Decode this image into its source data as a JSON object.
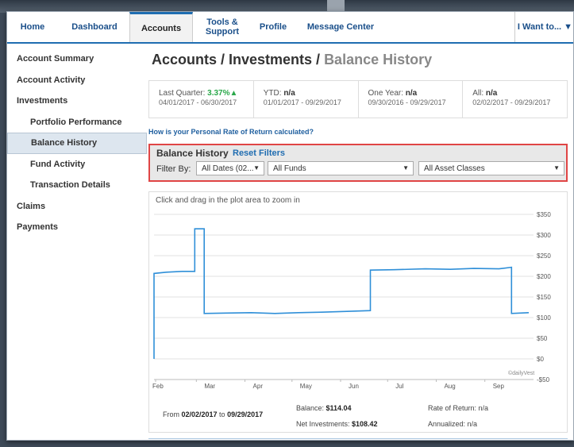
{
  "nav": {
    "items": [
      "Home",
      "Dashboard",
      "Accounts",
      "Tools & Support",
      "Profile",
      "Message Center"
    ],
    "iwant": "I Want to... ▼"
  },
  "sidebar": [
    {
      "label": "Account Summary",
      "sub": false
    },
    {
      "label": "Account Activity",
      "sub": false
    },
    {
      "label": "Investments",
      "sub": false
    },
    {
      "label": "Portfolio Performance",
      "sub": true
    },
    {
      "label": "Balance History",
      "sub": true,
      "active": true
    },
    {
      "label": "Fund Activity",
      "sub": true
    },
    {
      "label": "Transaction Details",
      "sub": true
    },
    {
      "label": "Claims",
      "sub": false
    },
    {
      "label": "Payments",
      "sub": false
    }
  ],
  "page": {
    "title_main": "Accounts / Investments / ",
    "title_sub": "Balance History"
  },
  "stats": [
    {
      "label": "Last Quarter: ",
      "value": "3.37%▲",
      "up": true,
      "dates": "04/01/2017 - 06/30/2017"
    },
    {
      "label": "YTD: ",
      "value": "n/a",
      "up": false,
      "dates": "01/01/2017 - 09/29/2017"
    },
    {
      "label": "One Year: ",
      "value": "n/a",
      "up": false,
      "dates": "09/30/2016 - 09/29/2017"
    },
    {
      "label": "All: ",
      "value": "n/a",
      "up": false,
      "dates": "02/02/2017 - 09/29/2017"
    }
  ],
  "ror_link": "How is your Personal Rate of Return calculated?",
  "filter": {
    "title": "Balance History",
    "reset": "Reset Filters",
    "label": "Filter By:",
    "dates": "All Dates (02...",
    "funds": "All Funds",
    "assets": "All Asset Classes"
  },
  "chart_hint": "Click and drag in the plot area to zoom in",
  "chart_data": {
    "type": "line",
    "credit": "©dailyVest",
    "xlabels": [
      "Feb",
      "Mar",
      "Apr",
      "May",
      "Jun",
      "Jul",
      "Aug",
      "Sep"
    ],
    "ytick_labels": [
      "$350",
      "$300",
      "$250",
      "$200",
      "$150",
      "$100",
      "$50",
      "$0",
      "-$50"
    ],
    "ytick_values": [
      350,
      300,
      250,
      200,
      150,
      100,
      50,
      0,
      -50
    ],
    "ylim": [
      -50,
      350
    ],
    "grid": true,
    "series": [
      {
        "color": "#2f8fd8",
        "points": [
          [
            "2017-02-02",
            0
          ],
          [
            "2017-02-02",
            207
          ],
          [
            "2017-02-10",
            210
          ],
          [
            "2017-02-20",
            212
          ],
          [
            "2017-02-28",
            212
          ],
          [
            "2017-02-28",
            315
          ],
          [
            "2017-03-06",
            315
          ],
          [
            "2017-03-06",
            110
          ],
          [
            "2017-03-20",
            111
          ],
          [
            "2017-04-05",
            112
          ],
          [
            "2017-04-20",
            110
          ],
          [
            "2017-05-05",
            112
          ],
          [
            "2017-05-20",
            113
          ],
          [
            "2017-06-05",
            115
          ],
          [
            "2017-06-20",
            117
          ],
          [
            "2017-06-20",
            215
          ],
          [
            "2017-07-05",
            216
          ],
          [
            "2017-07-25",
            218
          ],
          [
            "2017-08-10",
            217
          ],
          [
            "2017-08-25",
            219
          ],
          [
            "2017-09-10",
            218
          ],
          [
            "2017-09-18",
            222
          ],
          [
            "2017-09-18",
            110
          ],
          [
            "2017-09-29",
            112
          ]
        ]
      }
    ]
  },
  "summary": {
    "from_prefix": "From ",
    "from_date": "02/02/2017",
    "to_word": " to ",
    "to_date": "09/29/2017",
    "balance_label": "Balance: ",
    "balance": "$114.04",
    "net_label": "Net Investments: ",
    "net": "$108.42",
    "ror": "Rate of Return: n/a",
    "annualized": "Annualized: n/a"
  }
}
